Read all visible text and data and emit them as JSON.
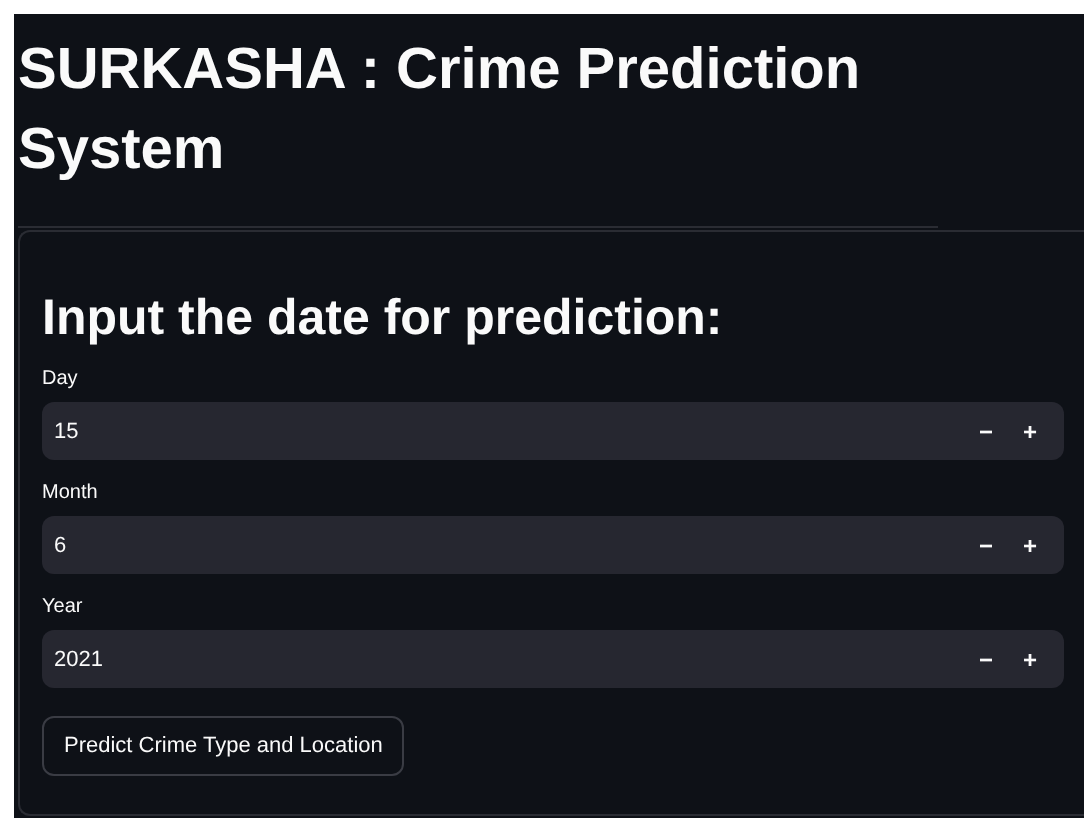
{
  "title": "SURKASHA : Crime Prediction System",
  "form": {
    "heading": "Input the date for prediction:",
    "fields": [
      {
        "label": "Day",
        "value": "15",
        "decrement": "−",
        "increment": "+"
      },
      {
        "label": "Month",
        "value": "6",
        "decrement": "−",
        "increment": "+"
      },
      {
        "label": "Year",
        "value": "2021",
        "decrement": "−",
        "increment": "+"
      }
    ],
    "submit_button": "Predict Crime Type and Location"
  }
}
